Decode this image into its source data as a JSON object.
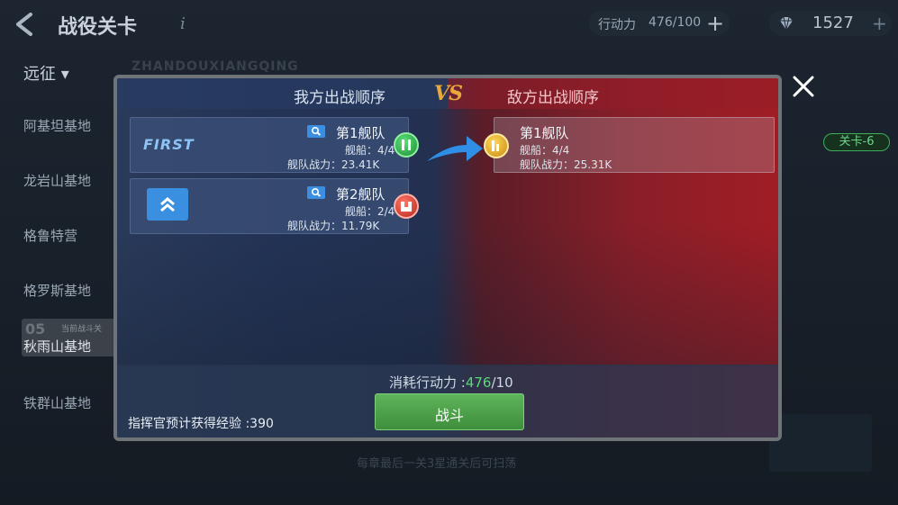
{
  "header": {
    "title": "战役关卡",
    "info_symbol": "i",
    "action_points_label": "行动力",
    "action_points_value": "476/100",
    "add_symbol": "+",
    "gems_value": "1527"
  },
  "sidebar": {
    "filter_label": "远征 ▾",
    "bases": [
      "阿基坦基地",
      "龙岩山基地",
      "格鲁特营",
      "格罗斯基地"
    ],
    "current": {
      "number": "05",
      "tag": "当前战斗关",
      "name": "秋雨山基地"
    },
    "last_base": "铁群山基地"
  },
  "background": {
    "stage_badge": "关卡-6",
    "bottom_hint": "每章最后一关3星通关后可扫荡",
    "watermark": "ZHANDOUXIANGQING"
  },
  "modal": {
    "ours_title": "我方出战顺序",
    "vs": "VS",
    "enemy_title": "敌方出战顺序",
    "own_fleets": [
      {
        "badge": "FIRST",
        "name": "第1舰队",
        "ships": "舰船：4/4",
        "power": "舰队战力：23.41K"
      },
      {
        "name": "第2舰队",
        "ships": "舰船：2/4",
        "power": "舰队战力：11.79K"
      }
    ],
    "enemy_fleets": [
      {
        "name": "第1舰队",
        "ships": "舰船：4/4",
        "power": "舰队战力：25.31K"
      }
    ],
    "cost_label": "消耗行动力 :",
    "cost_current": "476",
    "cost_required": "/10",
    "fight_label": "战斗",
    "exp_text": "指挥官预计获得经验 :390"
  },
  "colors": {
    "own_side": "#233356",
    "enemy_side": "#a11d25",
    "fight_button": "#4f9f4b",
    "cost_highlight": "#59d87a",
    "vs": "#e8a93a"
  },
  "icons": [
    "back-arrow-icon",
    "info-icon",
    "plus-icon",
    "diamond-icon",
    "search-icon",
    "double-chevron-up-icon",
    "order-marker-icon",
    "blue-arrow-icon",
    "close-icon"
  ]
}
